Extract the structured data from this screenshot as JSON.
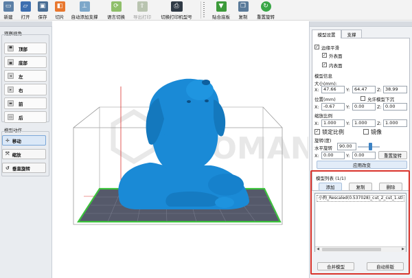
{
  "toolbar": {
    "items": [
      {
        "label": "新建",
        "icon": "new-file-icon",
        "color": "#5b7fa6"
      },
      {
        "label": "打开",
        "icon": "open-folder-icon",
        "color": "#3d6fb0"
      },
      {
        "label": "保存",
        "icon": "save-icon",
        "color": "#4a6e94"
      },
      {
        "label": "切片",
        "icon": "slice-icon",
        "color": "#e8772e"
      },
      {
        "label": "自动添加支撑",
        "icon": "auto-support-icon",
        "color": "#7da7c9"
      },
      {
        "label": "语言切换",
        "icon": "language-icon",
        "color": "#8fbf6a"
      },
      {
        "label": "导出打印",
        "icon": "export-print-icon",
        "color": "#b9c4b0",
        "disabled": true
      },
      {
        "label": "切换打印机型号",
        "icon": "printer-model-icon",
        "color": "#2f3a45"
      },
      {
        "label": "贴合底板",
        "icon": "lay-flat-icon",
        "color": "#3c9a3a"
      },
      {
        "label": "复制",
        "icon": "copy-icon",
        "color": "#5a7a99"
      },
      {
        "label": "重置旋转",
        "icon": "reset-rotation-icon",
        "color": "#3aa647"
      }
    ]
  },
  "left_panel": {
    "view_title": "观察视角",
    "views": [
      {
        "label": "顶部",
        "icon": "view-top-icon"
      },
      {
        "label": "底部",
        "icon": "view-bottom-icon"
      },
      {
        "label": "左",
        "icon": "view-left-icon"
      },
      {
        "label": "右",
        "icon": "view-right-icon"
      },
      {
        "label": "前",
        "icon": "view-front-icon"
      },
      {
        "label": "后",
        "icon": "view-back-icon"
      }
    ],
    "action_title": "模型动作",
    "actions": [
      {
        "label": "移动",
        "icon": "move-icon",
        "active": true
      },
      {
        "label": "缩放",
        "icon": "scale-icon",
        "active": false
      },
      {
        "label": "垂直旋转",
        "icon": "rotate-vertical-icon",
        "active": false
      }
    ]
  },
  "viewport": {
    "watermark": "ALOMAN",
    "bed_color": "#55596a",
    "bed_border_color": "#3cc23c",
    "model_color": "#1a8ad6"
  },
  "right_panel": {
    "tabs": [
      "模型设置",
      "支撑"
    ],
    "smoothing": {
      "label": "边缘平滑",
      "outer": "外表面",
      "inner": "内表面"
    },
    "model_info": {
      "title": "模型信息",
      "size_label": "大小(mm):",
      "size": {
        "x": "47.66",
        "y": "64.47",
        "z": "38.99"
      },
      "position_label": "位置(mm)",
      "allow_sink_label": "允许模型下沉",
      "position": {
        "x": "-0.67",
        "y": "0.00",
        "z": "0.00"
      },
      "scale_label": "缩放比例",
      "scale": {
        "x": "1.000",
        "y": "1.000",
        "z": "1.000"
      },
      "lock_ratio_label": "锁定比例",
      "mirror_label": "镜像",
      "rotation_label": "旋转(度)",
      "horizontal_rotation_label": "水平旋转",
      "horizontal_rotation_value": "90.00",
      "rotation": {
        "x": "0.00",
        "y": "0.00"
      },
      "reset_rotation_button": "重置旋转",
      "apply_button": "应用改变"
    },
    "model_list": {
      "title": "模型列表 (1/1)",
      "add_button": "添加",
      "copy_button": "复制",
      "delete_button": "删除",
      "items": [
        "小狗_Rescaled(0.537028)_cut_2_cut_1.stl"
      ],
      "merge_button": "合并模型",
      "auto_arrange_button": "自动排版"
    }
  },
  "axis_labels": {
    "x": "X:",
    "y": "Y:",
    "z": "Z:"
  }
}
